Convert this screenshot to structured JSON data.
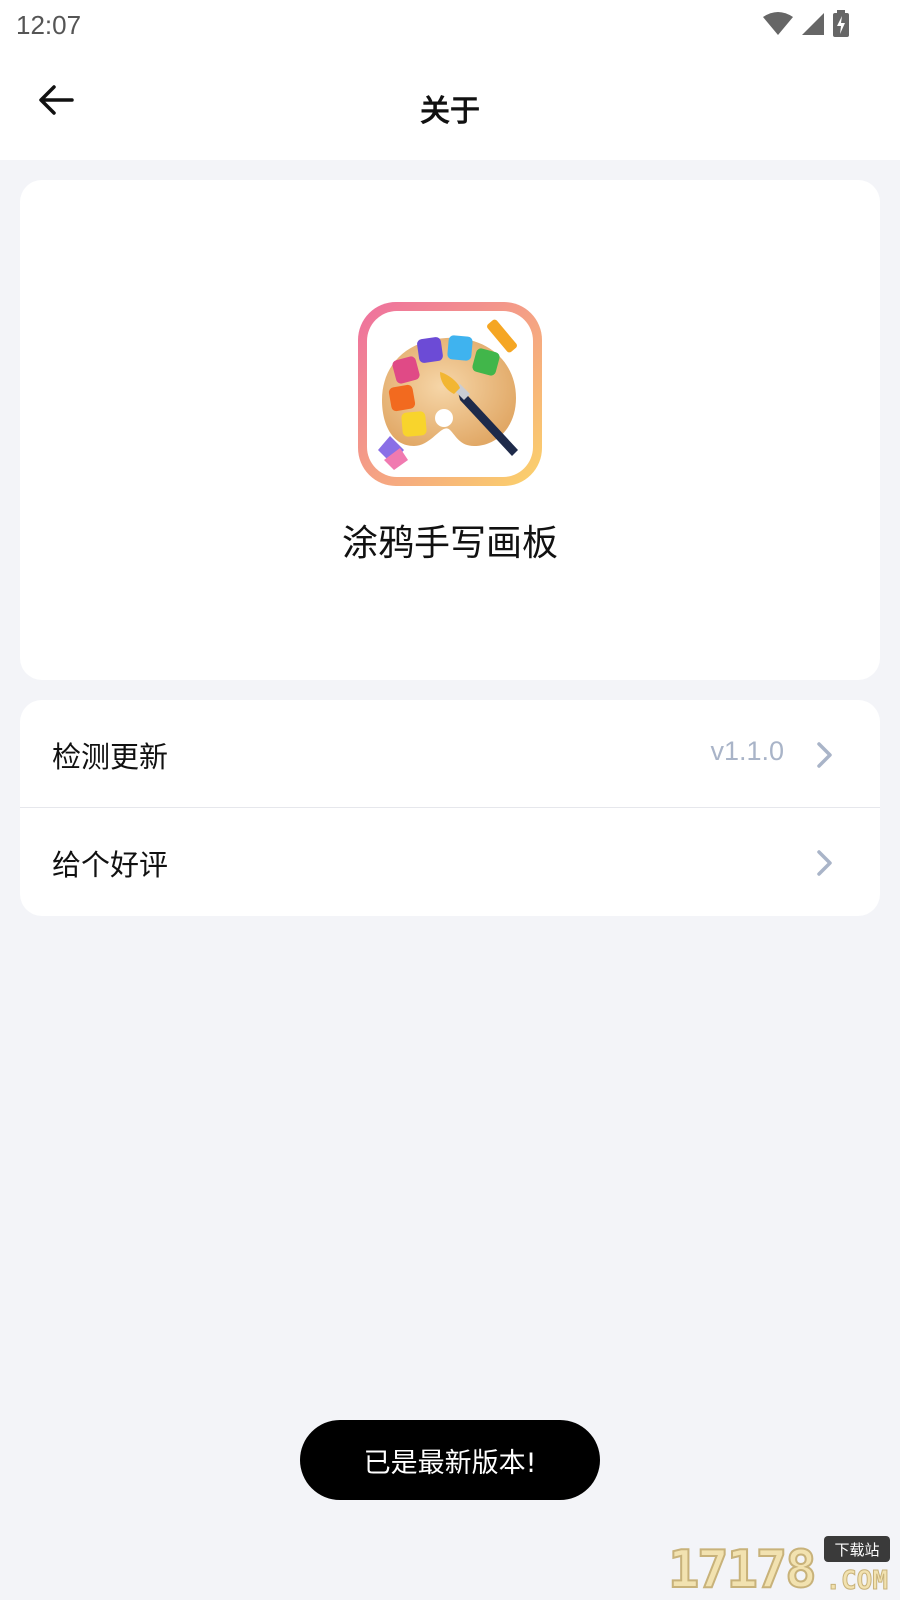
{
  "status_bar": {
    "time": "12:07",
    "icons": [
      "wifi-icon",
      "signal-icon",
      "battery-charging-icon"
    ]
  },
  "header": {
    "title": "关于",
    "back_icon": "arrow-left-icon"
  },
  "app": {
    "name": "涂鸦手写画板",
    "icon": "palette-app-icon"
  },
  "menu": {
    "items": [
      {
        "label": "检测更新",
        "value": "v1.1.0",
        "icon": "chevron-right-icon"
      },
      {
        "label": "给个好评",
        "value": "",
        "icon": "chevron-right-icon"
      }
    ]
  },
  "toast": {
    "message": "已是最新版本!"
  },
  "watermark": {
    "digits": "17178",
    "site_label": "下载站",
    "suffix": ".COM"
  },
  "colors": {
    "background": "#f3f4f8",
    "card": "#ffffff",
    "muted_text": "#a9b4c8",
    "toast_bg": "#000000",
    "icon_gradient_start": "#ee6e9f",
    "icon_gradient_end": "#fbd36a"
  }
}
